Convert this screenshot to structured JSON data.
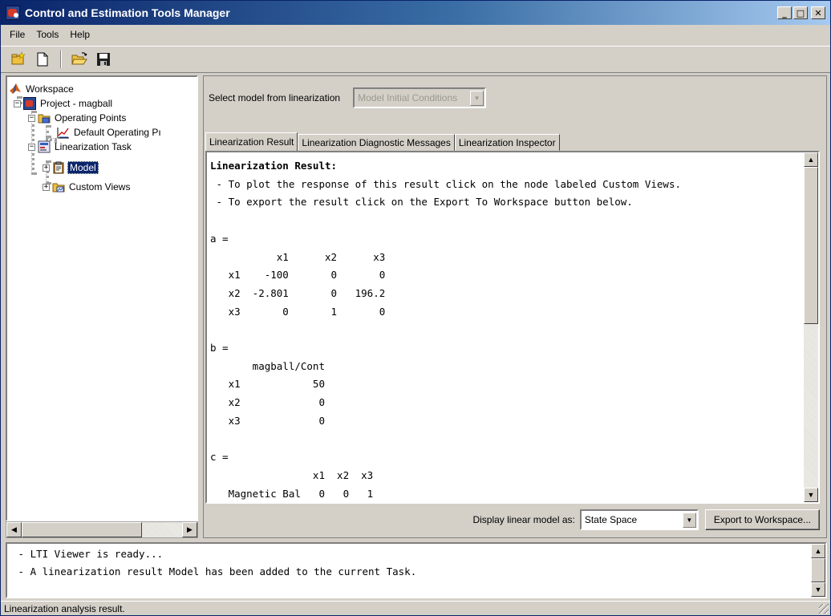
{
  "window": {
    "title": "Control and Estimation Tools Manager"
  },
  "menu": [
    "File",
    "Tools",
    "Help"
  ],
  "toolbar": [
    "new-project-icon",
    "new-task-icon",
    "open-icon",
    "save-icon"
  ],
  "tree": {
    "workspace": "Workspace",
    "project": "Project - magball",
    "operating_points": "Operating Points",
    "default_op": "Default Operating Pı",
    "linearization_task": "Linearization Task",
    "model": "Model",
    "custom_views": "Custom Views"
  },
  "panel": {
    "select_label": "Select model from linearization",
    "select_value": "Model Initial Conditions",
    "tabs": [
      "Linearization Result",
      "Linearization Diagnostic Messages",
      "Linearization Inspector"
    ],
    "result_title": "Linearization Result:",
    "result_body": "\n - To plot the response of this result click on the node labeled Custom Views.\n - To export the result click on the Export To Workspace button below.\n\na =\n           x1      x2      x3\n   x1    -100       0       0\n   x2  -2.801       0   196.2\n   x3       0       1       0\n\nb =\n       magball/Cont\n   x1            50\n   x2             0\n   x3             0\n\nc =\n                 x1  x2  x3\n   Magnetic Bal   0   0   1",
    "display_label": "Display linear model as:",
    "display_value": "State Space",
    "export_button": "Export to Workspace..."
  },
  "console": {
    "lines": " - LTI Viewer is ready...\n - A linearization result Model has been added to the current Task."
  },
  "status": "Linearization analysis result."
}
